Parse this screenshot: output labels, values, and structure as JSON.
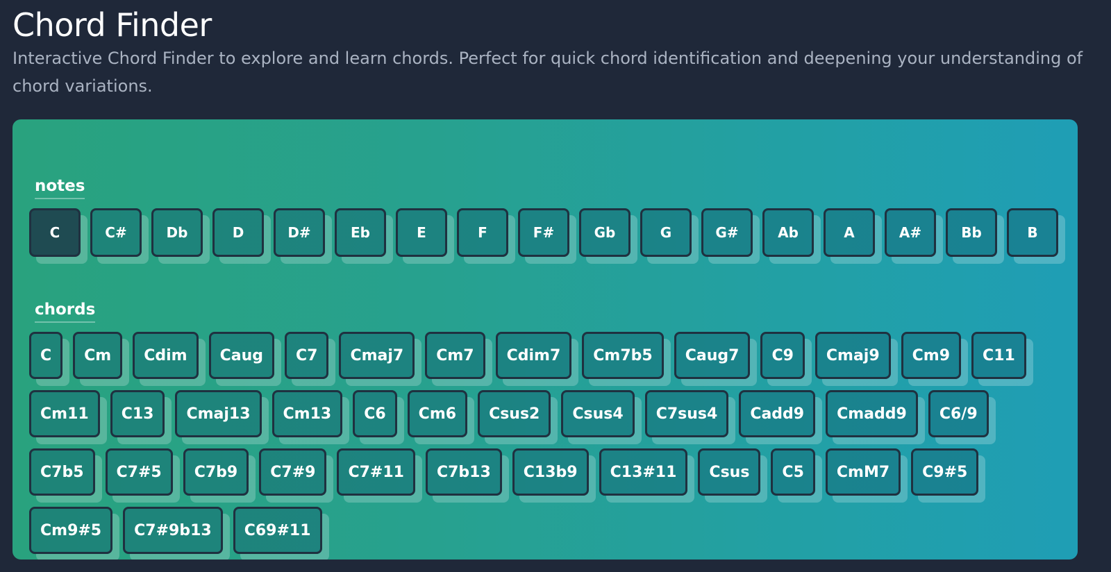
{
  "header": {
    "title": "Chord Finder",
    "description": "Interactive Chord Finder to explore and learn chords. Perfect for quick chord identification and deepening your understanding of chord variations."
  },
  "notes": {
    "label": "notes",
    "selected": "C",
    "items": [
      "C",
      "C#",
      "Db",
      "D",
      "D#",
      "Eb",
      "E",
      "F",
      "F#",
      "Gb",
      "G",
      "G#",
      "Ab",
      "A",
      "A#",
      "Bb",
      "B"
    ]
  },
  "chords": {
    "label": "chords",
    "items": [
      "C",
      "Cm",
      "Cdim",
      "Caug",
      "C7",
      "Cmaj7",
      "Cm7",
      "Cdim7",
      "Cm7b5",
      "Caug7",
      "C9",
      "Cmaj9",
      "Cm9",
      "C11",
      "Cm11",
      "C13",
      "Cmaj13",
      "Cm13",
      "C6",
      "Cm6",
      "Csus2",
      "Csus4",
      "C7sus4",
      "Cadd9",
      "Cmadd9",
      "C6/9",
      "C7b5",
      "C7#5",
      "C7b9",
      "C7#9",
      "C7#11",
      "C7b13",
      "C13b9",
      "C13#11",
      "Csus",
      "C5",
      "CmM7",
      "C9#5",
      "Cm9#5",
      "C7#9b13",
      "C69#11"
    ]
  }
}
